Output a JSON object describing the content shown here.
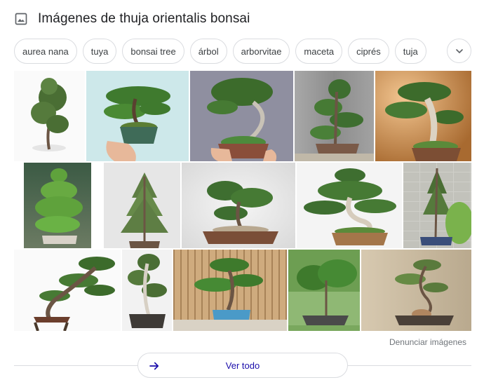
{
  "header": {
    "title": "Imágenes de thuja orientalis bonsai",
    "icon": "image-icon"
  },
  "chips": [
    "aurea nana",
    "tuya",
    "bonsai tree",
    "árbol",
    "arborvitae",
    "maceta",
    "ciprés",
    "tuja"
  ],
  "chips_more_icon": "chevron-down-icon",
  "images": [
    "bonsai-photo-1",
    "bonsai-photo-2",
    "bonsai-photo-3",
    "bonsai-photo-4",
    "bonsai-photo-5",
    "bonsai-photo-6",
    "bonsai-photo-7",
    "bonsai-photo-8",
    "bonsai-photo-9",
    "bonsai-photo-10",
    "bonsai-photo-11",
    "bonsai-photo-12",
    "bonsai-photo-13",
    "bonsai-photo-14",
    "bonsai-photo-15"
  ],
  "footer": {
    "report_label": "Denunciar imágenes",
    "view_all_label": "Ver todo",
    "view_all_icon": "arrow-right-icon"
  },
  "colors": {
    "link": "#1a0dab",
    "arrow": "#1a0dab",
    "border": "#dadce0",
    "foliage": "#4a7a2e",
    "trunk": "#6b5544"
  }
}
